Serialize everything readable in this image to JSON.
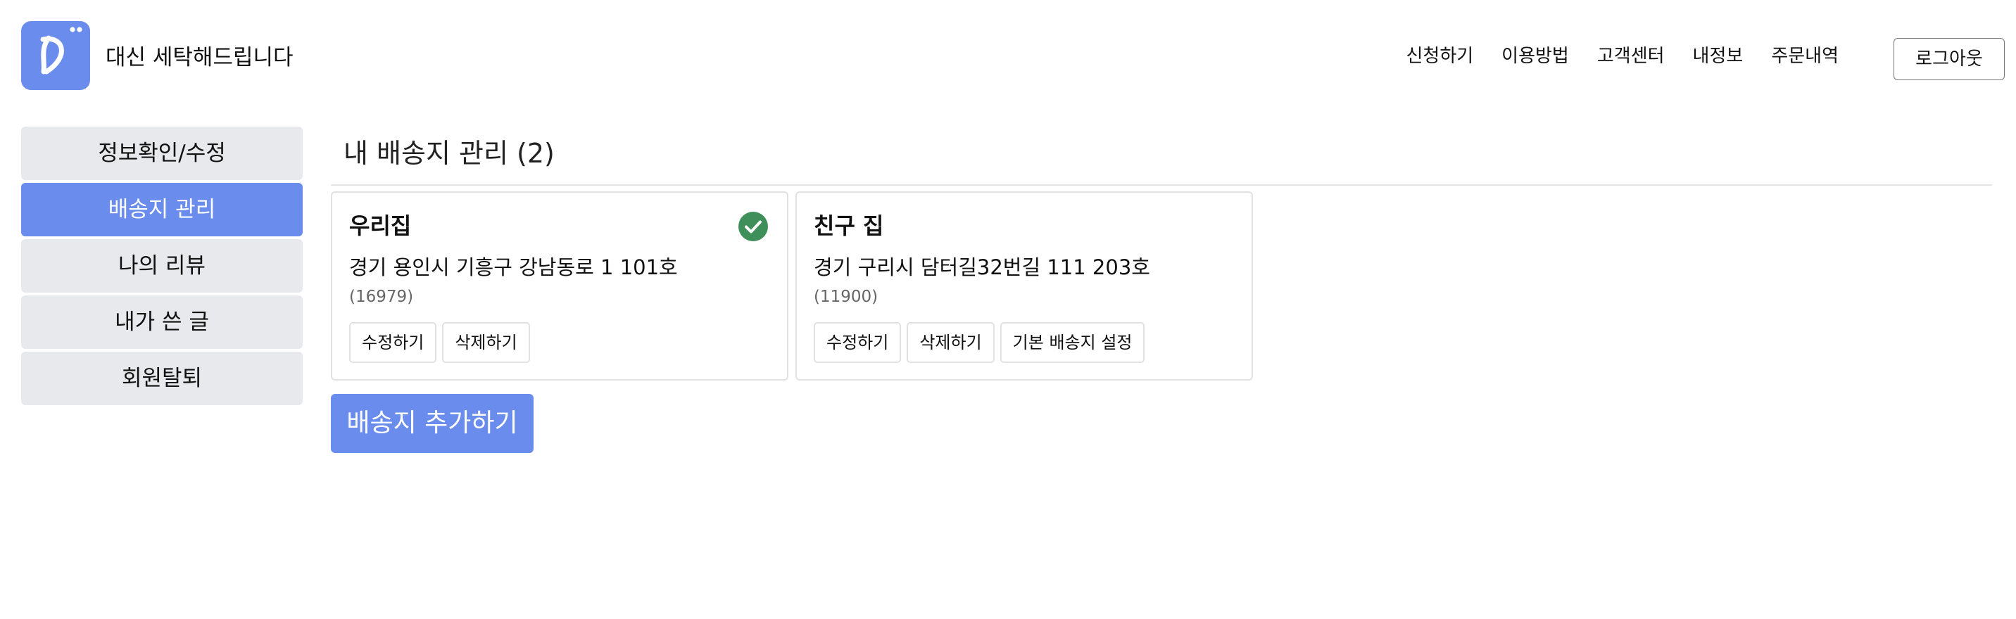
{
  "header": {
    "brand": "대신 세탁해드립니다",
    "logo_icon": "letter-d-logo-icon",
    "logo_color": "#6a8ded",
    "nav": [
      "신청하기",
      "이용방법",
      "고객센터",
      "내정보",
      "주문내역"
    ],
    "logout_label": "로그아웃"
  },
  "sidebar": {
    "items": [
      {
        "label": "정보확인/수정",
        "active": false
      },
      {
        "label": "배송지 관리",
        "active": true
      },
      {
        "label": "나의 리뷰",
        "active": false
      },
      {
        "label": "내가 쓴 글",
        "active": false
      },
      {
        "label": "회원탈퇴",
        "active": false
      }
    ]
  },
  "main": {
    "title": "내 배송지 관리 (2)",
    "addresses": [
      {
        "name": "우리집",
        "address": "경기 용인시 기흥구 강남동로 1 101호",
        "zip": "(16979)",
        "is_default": true,
        "default_icon": "check-circle-icon",
        "buttons": [
          "수정하기",
          "삭제하기"
        ]
      },
      {
        "name": "친구 집",
        "address": "경기 구리시 담터길32번길 111 203호",
        "zip": "(11900)",
        "is_default": false,
        "buttons": [
          "수정하기",
          "삭제하기",
          "기본 배송지 설정"
        ]
      }
    ],
    "add_button": "배송지 추가하기"
  },
  "colors": {
    "accent": "#6a8ded",
    "sidebar_bg": "#e8e9ec",
    "default_check": "#3f8f5a"
  }
}
